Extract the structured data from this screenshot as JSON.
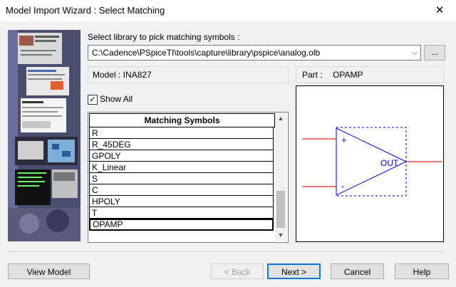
{
  "window": {
    "title": "Model Import Wizard : Select Matching",
    "close": "✕"
  },
  "library": {
    "label": "Select library to pick matching symbols :",
    "path": "C:\\Cadence\\PSpiceTI\\tools\\capture\\library\\pspice\\analog.olb",
    "browse": "..."
  },
  "model": {
    "label": "Model : INA827"
  },
  "part": {
    "label": "Part :",
    "name": "OPAMP"
  },
  "show_all": {
    "label": "Show All",
    "checked": true
  },
  "symbols": {
    "header": "Matching Symbols",
    "items": [
      "R",
      "R_45DEG",
      "GPOLY",
      "K_Linear",
      "S",
      "C",
      "HPOLY",
      "T",
      "OPAMP"
    ],
    "selected": "OPAMP"
  },
  "symbol_preview": {
    "plus": "+",
    "minus": "-",
    "out": "OUT"
  },
  "buttons": {
    "view_model": "View Model",
    "back": "< Back",
    "next": "Next >",
    "cancel": "Cancel",
    "help": "Help"
  }
}
